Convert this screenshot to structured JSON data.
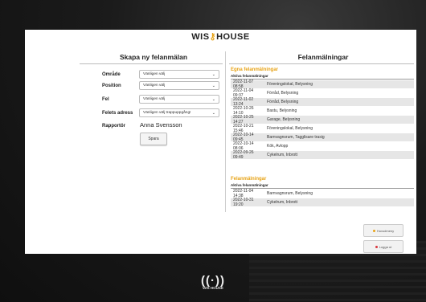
{
  "brand": {
    "name": "WIS HOUSE",
    "name_left": "WIS",
    "name_right": "HOUSE"
  },
  "left_panel": {
    "title": "Skapa ny felanmälan",
    "fields": [
      {
        "label": "Område",
        "value": "Vänligen välj"
      },
      {
        "label": "Position",
        "value": "Vänligen välj"
      },
      {
        "label": "Fel",
        "value": "Vänligen välj"
      },
      {
        "label": "Felets adress",
        "value": "Vänligen välj trappuppgång!"
      }
    ],
    "reporter_label": "Rapportör",
    "reporter_value": "Anna Svensson",
    "save_label": "Spara"
  },
  "right_panel": {
    "title": "Felanmälningar",
    "own": {
      "title": "Egna felanmälningar",
      "subtitle": "Aktiva felanmälningar",
      "rows": [
        {
          "ts": "2022-11-07 08:58",
          "desc": "Föreningslokal, Belysning"
        },
        {
          "ts": "2022-11-04 09:37",
          "desc": "Förråd, Belysning"
        },
        {
          "ts": "2022-11-02 13:24",
          "desc": "Förråd, Belysning"
        },
        {
          "ts": "2022-10-26 14:10",
          "desc": "Bastu, Belysning"
        },
        {
          "ts": "2022-10-25 14:27",
          "desc": "Garage, Belysning"
        },
        {
          "ts": "2022-10-21 15:46",
          "desc": "Föreningslokal, Belysning"
        },
        {
          "ts": "2022-10-14 09:45",
          "desc": "Barnvagnsrum, Tagglisare trasig"
        },
        {
          "ts": "2022-10-14 08:06",
          "desc": "Kök, Avlopp"
        },
        {
          "ts": "2022-09-26 09:49",
          "desc": "Cykelrum, Inbrott"
        }
      ]
    },
    "all": {
      "title": "Felanmälningar",
      "subtitle": "Aktiva felanmälningar",
      "rows": [
        {
          "ts": "2022-11-04 14:38",
          "desc": "Barnvagnsrum, Belysning"
        },
        {
          "ts": "2022-10-31 19:20",
          "desc": "Cykelrum, Inbrott"
        }
      ]
    }
  },
  "side_buttons": {
    "menu_label": "Huvudmeny",
    "logout_label": "Logga ut",
    "menu_dot_color": "#e7a317",
    "logout_dot_color": "#d9363e"
  },
  "colors": {
    "accent": "#e7a317"
  }
}
